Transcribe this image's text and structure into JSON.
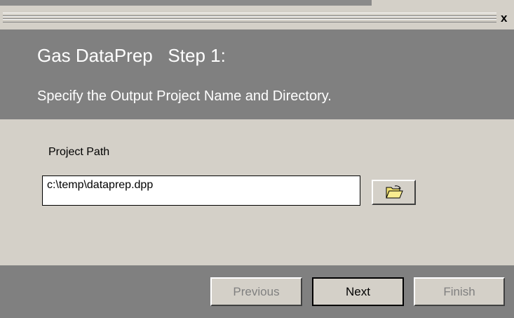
{
  "window": {
    "close_glyph": "x"
  },
  "header": {
    "app_name": "Gas DataPrep",
    "step": "Step 1:",
    "subtitle": "Specify the Output Project Name and Directory."
  },
  "content": {
    "project_path_label": "Project Path",
    "project_path_value": "c:\\temp\\dataprep.dpp",
    "browse_icon": "folder-open-icon"
  },
  "footer": {
    "previous_label": "Previous",
    "next_label": "Next",
    "finish_label": "Finish"
  }
}
